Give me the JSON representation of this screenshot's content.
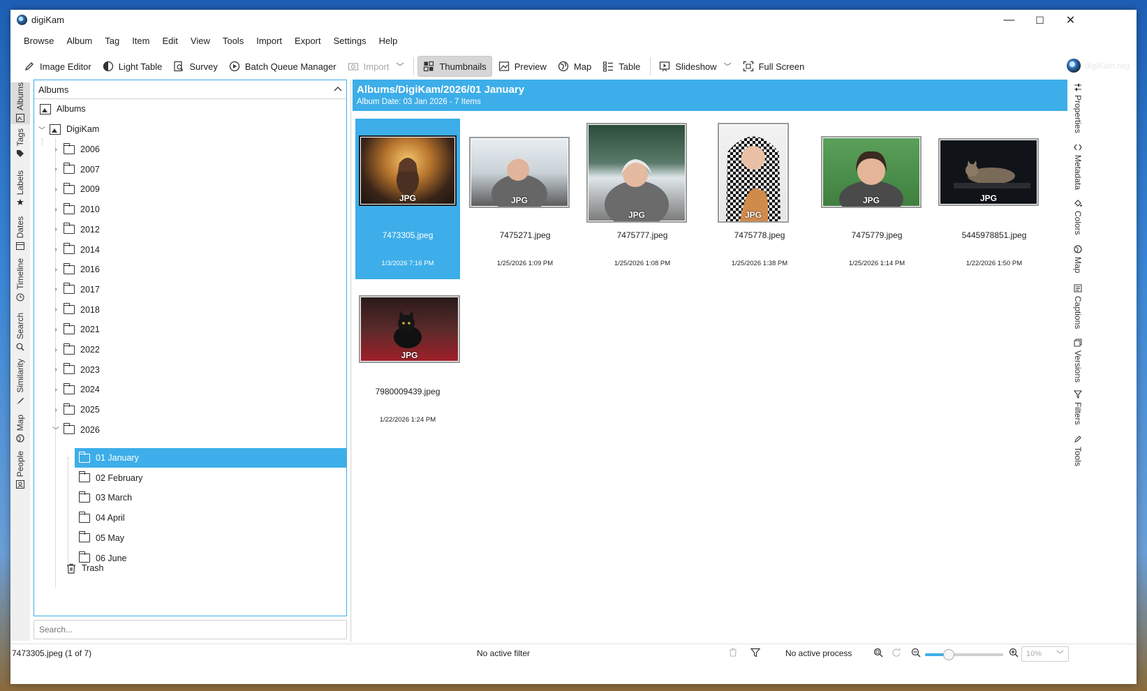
{
  "window": {
    "title": "digiKam",
    "minimize": "—",
    "maximize": "☐",
    "close": "✕"
  },
  "menu": [
    "Browse",
    "Album",
    "Tag",
    "Item",
    "Edit",
    "View",
    "Tools",
    "Import",
    "Export",
    "Settings",
    "Help"
  ],
  "toolbar": {
    "image_editor": "Image Editor",
    "light_table": "Light Table",
    "survey": "Survey",
    "batch_queue": "Batch Queue Manager",
    "import": "Import",
    "thumbnails": "Thumbnails",
    "preview": "Preview",
    "map": "Map",
    "table": "Table",
    "slideshow": "Slideshow",
    "full_screen": "Full Screen",
    "brand": "digiKam.org"
  },
  "left_tabs": [
    "Albums",
    "Tags",
    "Labels",
    "Dates",
    "Timeline",
    "Search",
    "Similarity",
    "Map",
    "People"
  ],
  "right_tabs": [
    "Properties",
    "Metadata",
    "Colors",
    "Map",
    "Captions",
    "Versions",
    "Filters",
    "Tools"
  ],
  "albums_panel": {
    "title": "Albums",
    "root": "Albums",
    "collection": "DigiKam",
    "years": [
      "2006",
      "2007",
      "2009",
      "2010",
      "2012",
      "2014",
      "2016",
      "2017",
      "2018",
      "2021",
      "2022",
      "2023",
      "2024",
      "2025",
      "2026"
    ],
    "months": [
      "01 January",
      "02 February",
      "03 March",
      "04 April",
      "05 May",
      "06 June"
    ],
    "trash": "Trash",
    "search_placeholder": "Search..."
  },
  "album_header": {
    "path": "Albums/DigiKam/2026/01 January",
    "subtitle": "Album Date: 03 Jan 2026 - 7 Items"
  },
  "thumbnails": [
    {
      "name": "7473305.jpeg",
      "date": "1/3/2026 7:16 PM",
      "badge": "JPG",
      "selected": true
    },
    {
      "name": "7475271.jpeg",
      "date": "1/25/2026 1:09 PM",
      "badge": "JPG"
    },
    {
      "name": "7475777.jpeg",
      "date": "1/25/2026 1:08 PM",
      "badge": "JPG"
    },
    {
      "name": "7475778.jpeg",
      "date": "1/25/2026 1:38 PM",
      "badge": "JPG"
    },
    {
      "name": "7475779.jpeg",
      "date": "1/25/2026 1:14 PM",
      "badge": "JPG"
    },
    {
      "name": "5445978851.jpeg",
      "date": "1/22/2026 1:50 PM",
      "badge": "JPG"
    },
    {
      "name": "7980009439.jpeg",
      "date": "1/22/2026 1:24 PM",
      "badge": "JPG"
    }
  ],
  "status": {
    "item": "7473305.jpeg (1 of 7)",
    "filter": "No active filter",
    "process": "No active process",
    "zoom": "10%",
    "zoom_slider_fraction": 0.3
  },
  "colors": {
    "accent": "#3daee9"
  }
}
